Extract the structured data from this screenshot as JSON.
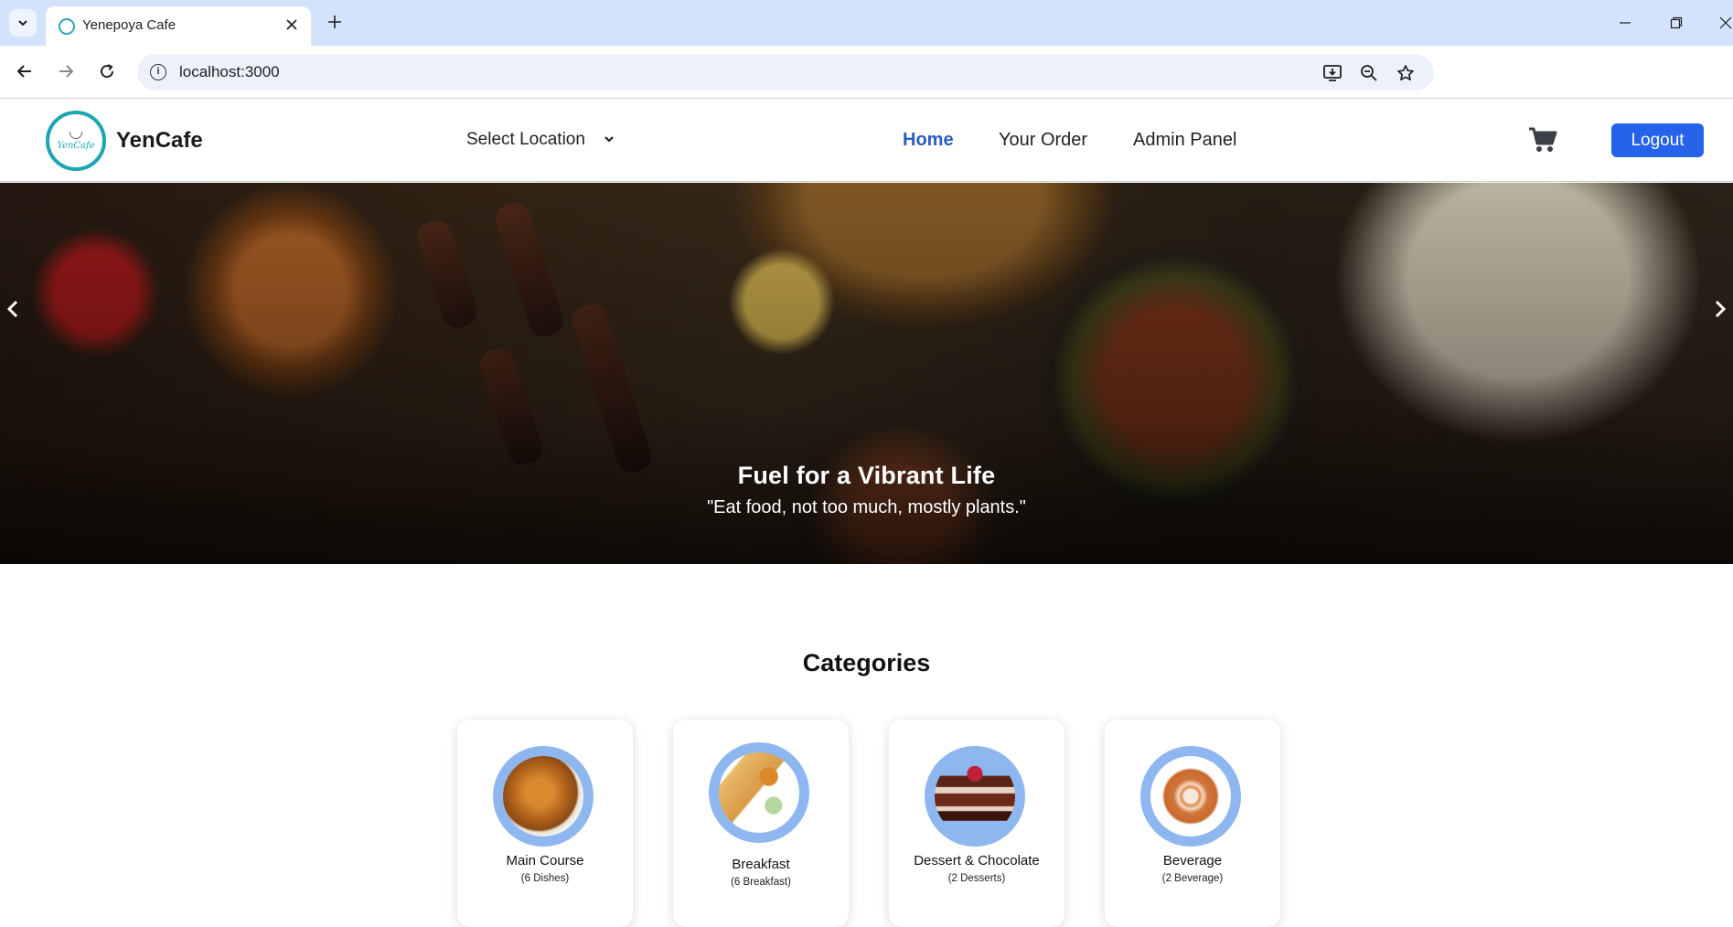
{
  "browser": {
    "tab_title": "Yenepoya Cafe",
    "url": "localhost:3000"
  },
  "header": {
    "brand_logo_text": "YenCafe",
    "brand_name": "YenCafe",
    "location_label": "Select Location",
    "nav": {
      "home": "Home",
      "orders": "Your Order",
      "admin": "Admin Panel"
    },
    "logout_label": "Logout",
    "accent_color": "#2563eb"
  },
  "hero": {
    "title": "Fuel for a Vibrant Life",
    "subtitle": "\"Eat food, not too much, mostly plants.\""
  },
  "categories": {
    "heading": "Categories",
    "items": [
      {
        "name": "Main Course",
        "count": "(6 Dishes)",
        "icon": "biryani-plate"
      },
      {
        "name": "Breakfast",
        "count": "(6 Breakfast)",
        "icon": "dosa-plate"
      },
      {
        "name": "Dessert & Chocolate",
        "count": "(2 Desserts)",
        "icon": "cake-slice"
      },
      {
        "name": "Beverage",
        "count": "(2 Beverage)",
        "icon": "latte-cup"
      }
    ]
  }
}
